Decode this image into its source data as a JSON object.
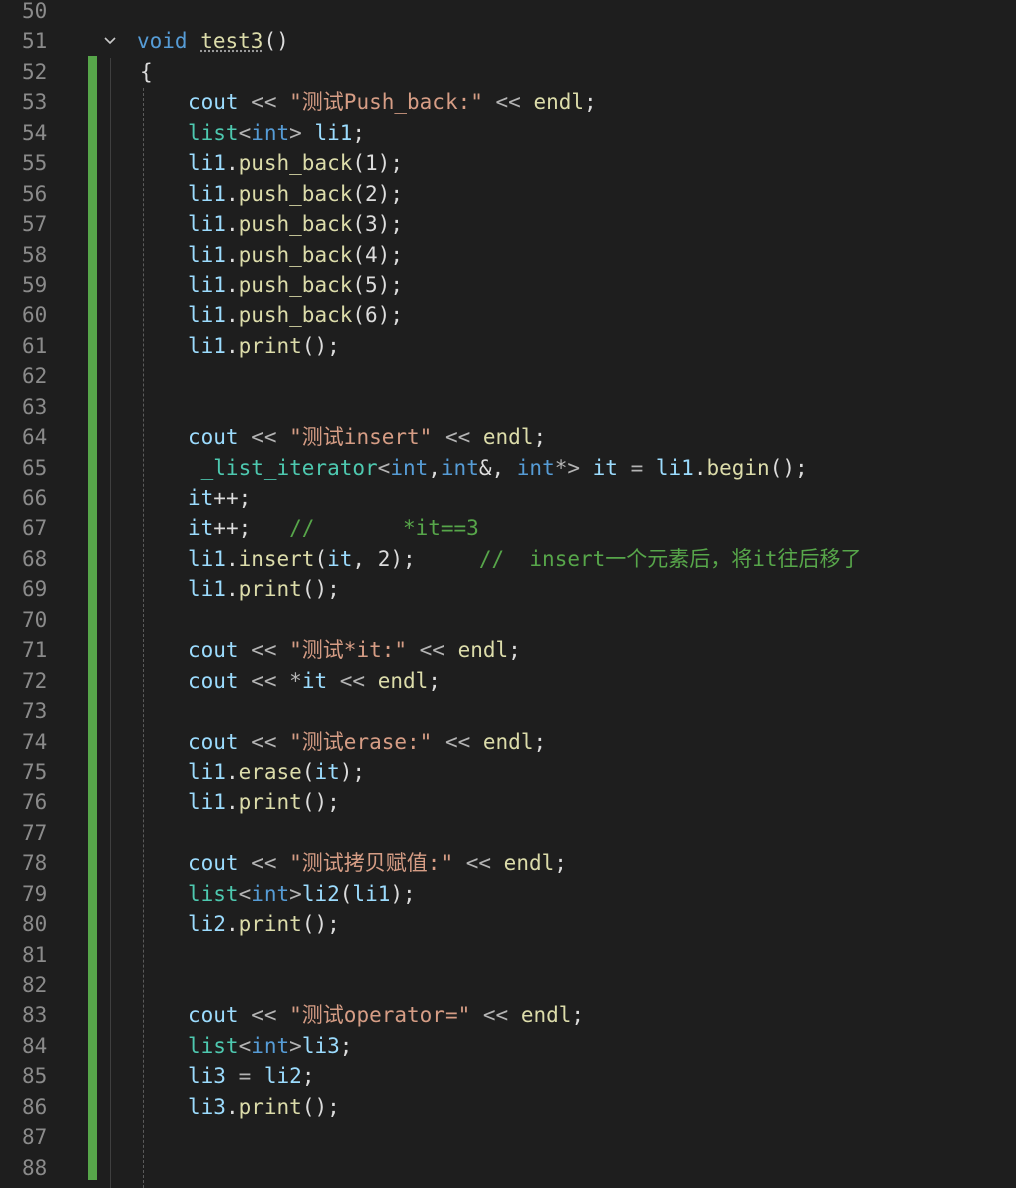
{
  "editor": {
    "lines": [
      {
        "n": "50",
        "indent": "none",
        "tokens": []
      },
      {
        "n": "51",
        "indent": "top",
        "fold": "⌵",
        "tokens": [
          {
            "t": "void",
            "c": "kw"
          },
          {
            "t": " ",
            "c": "def"
          },
          {
            "t": "test3",
            "c": "fn",
            "u": true
          },
          {
            "t": "()",
            "c": "def"
          }
        ]
      },
      {
        "n": "52",
        "indent": "brace",
        "tokens": [
          {
            "t": "{",
            "c": "def"
          }
        ]
      },
      {
        "n": "53",
        "indent": "body",
        "tokens": [
          {
            "t": "cout",
            "c": "var"
          },
          {
            "t": " << ",
            "c": "op"
          },
          {
            "t": "\"测试Push_back:\"",
            "c": "str"
          },
          {
            "t": " << ",
            "c": "op"
          },
          {
            "t": "endl",
            "c": "fn"
          },
          {
            "t": ";",
            "c": "def"
          }
        ]
      },
      {
        "n": "54",
        "indent": "body",
        "tokens": [
          {
            "t": "list",
            "c": "type"
          },
          {
            "t": "<",
            "c": "op"
          },
          {
            "t": "int",
            "c": "kw"
          },
          {
            "t": ">",
            "c": "op"
          },
          {
            "t": " li1",
            "c": "var"
          },
          {
            "t": ";",
            "c": "def"
          }
        ]
      },
      {
        "n": "55",
        "indent": "body",
        "tokens": [
          {
            "t": "li1",
            "c": "var"
          },
          {
            "t": ".",
            "c": "def"
          },
          {
            "t": "push_back",
            "c": "fn"
          },
          {
            "t": "(1);",
            "c": "def"
          }
        ]
      },
      {
        "n": "56",
        "indent": "body",
        "tokens": [
          {
            "t": "li1",
            "c": "var"
          },
          {
            "t": ".",
            "c": "def"
          },
          {
            "t": "push_back",
            "c": "fn"
          },
          {
            "t": "(2);",
            "c": "def"
          }
        ]
      },
      {
        "n": "57",
        "indent": "body",
        "tokens": [
          {
            "t": "li1",
            "c": "var"
          },
          {
            "t": ".",
            "c": "def"
          },
          {
            "t": "push_back",
            "c": "fn"
          },
          {
            "t": "(3);",
            "c": "def"
          }
        ]
      },
      {
        "n": "58",
        "indent": "body",
        "tokens": [
          {
            "t": "li1",
            "c": "var"
          },
          {
            "t": ".",
            "c": "def"
          },
          {
            "t": "push_back",
            "c": "fn"
          },
          {
            "t": "(4);",
            "c": "def"
          }
        ]
      },
      {
        "n": "59",
        "indent": "body",
        "tokens": [
          {
            "t": "li1",
            "c": "var"
          },
          {
            "t": ".",
            "c": "def"
          },
          {
            "t": "push_back",
            "c": "fn"
          },
          {
            "t": "(5);",
            "c": "def"
          }
        ]
      },
      {
        "n": "60",
        "indent": "body",
        "tokens": [
          {
            "t": "li1",
            "c": "var"
          },
          {
            "t": ".",
            "c": "def"
          },
          {
            "t": "push_back",
            "c": "fn"
          },
          {
            "t": "(6);",
            "c": "def"
          }
        ]
      },
      {
        "n": "61",
        "indent": "body",
        "tokens": [
          {
            "t": "li1",
            "c": "var"
          },
          {
            "t": ".",
            "c": "def"
          },
          {
            "t": "print",
            "c": "fn"
          },
          {
            "t": "();",
            "c": "def"
          }
        ]
      },
      {
        "n": "62",
        "indent": "body",
        "tokens": []
      },
      {
        "n": "63",
        "indent": "body",
        "tokens": []
      },
      {
        "n": "64",
        "indent": "body",
        "tokens": [
          {
            "t": "cout",
            "c": "var"
          },
          {
            "t": " << ",
            "c": "op"
          },
          {
            "t": "\"测试insert\"",
            "c": "str"
          },
          {
            "t": " << ",
            "c": "op"
          },
          {
            "t": "endl",
            "c": "fn"
          },
          {
            "t": ";",
            "c": "def"
          }
        ]
      },
      {
        "n": "65",
        "indent": "body",
        "tokens": [
          {
            "t": " _list_iterator",
            "c": "type"
          },
          {
            "t": "<",
            "c": "op"
          },
          {
            "t": "int",
            "c": "kw"
          },
          {
            "t": ",",
            "c": "def"
          },
          {
            "t": "int",
            "c": "kw"
          },
          {
            "t": "&, ",
            "c": "def"
          },
          {
            "t": "int",
            "c": "kw"
          },
          {
            "t": "*>",
            "c": "op"
          },
          {
            "t": " it",
            "c": "var"
          },
          {
            "t": " = ",
            "c": "op"
          },
          {
            "t": "li1",
            "c": "var"
          },
          {
            "t": ".",
            "c": "def"
          },
          {
            "t": "begin",
            "c": "fn"
          },
          {
            "t": "();",
            "c": "def"
          }
        ]
      },
      {
        "n": "66",
        "indent": "body",
        "tokens": [
          {
            "t": "it",
            "c": "var"
          },
          {
            "t": "++;",
            "c": "def"
          }
        ]
      },
      {
        "n": "67",
        "indent": "body",
        "tokens": [
          {
            "t": "it",
            "c": "var"
          },
          {
            "t": "++;",
            "c": "def"
          },
          {
            "t": "   //       *it==3",
            "c": "cmt"
          }
        ]
      },
      {
        "n": "68",
        "indent": "body",
        "tokens": [
          {
            "t": "li1",
            "c": "var"
          },
          {
            "t": ".",
            "c": "def"
          },
          {
            "t": "insert",
            "c": "fn"
          },
          {
            "t": "(",
            "c": "def"
          },
          {
            "t": "it",
            "c": "var"
          },
          {
            "t": ", 2);",
            "c": "def"
          },
          {
            "t": "     //  insert一个元素后，将it往后移了",
            "c": "cmt"
          }
        ]
      },
      {
        "n": "69",
        "indent": "body",
        "tokens": [
          {
            "t": "li1",
            "c": "var"
          },
          {
            "t": ".",
            "c": "def"
          },
          {
            "t": "print",
            "c": "fn"
          },
          {
            "t": "();",
            "c": "def"
          }
        ]
      },
      {
        "n": "70",
        "indent": "body",
        "tokens": []
      },
      {
        "n": "71",
        "indent": "body",
        "tokens": [
          {
            "t": "cout",
            "c": "var"
          },
          {
            "t": " << ",
            "c": "op"
          },
          {
            "t": "\"测试*it:\"",
            "c": "str"
          },
          {
            "t": " << ",
            "c": "op"
          },
          {
            "t": "endl",
            "c": "fn"
          },
          {
            "t": ";",
            "c": "def"
          }
        ]
      },
      {
        "n": "72",
        "indent": "body",
        "tokens": [
          {
            "t": "cout",
            "c": "var"
          },
          {
            "t": " << ",
            "c": "op"
          },
          {
            "t": "*",
            "c": "op"
          },
          {
            "t": "it",
            "c": "var"
          },
          {
            "t": " << ",
            "c": "op"
          },
          {
            "t": "endl",
            "c": "fn"
          },
          {
            "t": ";",
            "c": "def"
          }
        ]
      },
      {
        "n": "73",
        "indent": "body",
        "tokens": []
      },
      {
        "n": "74",
        "indent": "body",
        "tokens": [
          {
            "t": "cout",
            "c": "var"
          },
          {
            "t": " << ",
            "c": "op"
          },
          {
            "t": "\"测试erase:\"",
            "c": "str"
          },
          {
            "t": " << ",
            "c": "op"
          },
          {
            "t": "endl",
            "c": "fn"
          },
          {
            "t": ";",
            "c": "def"
          }
        ]
      },
      {
        "n": "75",
        "indent": "body",
        "tokens": [
          {
            "t": "li1",
            "c": "var"
          },
          {
            "t": ".",
            "c": "def"
          },
          {
            "t": "erase",
            "c": "fn"
          },
          {
            "t": "(",
            "c": "def"
          },
          {
            "t": "it",
            "c": "var"
          },
          {
            "t": ");",
            "c": "def"
          }
        ]
      },
      {
        "n": "76",
        "indent": "body",
        "tokens": [
          {
            "t": "li1",
            "c": "var"
          },
          {
            "t": ".",
            "c": "def"
          },
          {
            "t": "print",
            "c": "fn"
          },
          {
            "t": "();",
            "c": "def"
          }
        ]
      },
      {
        "n": "77",
        "indent": "body",
        "tokens": []
      },
      {
        "n": "78",
        "indent": "body",
        "tokens": [
          {
            "t": "cout",
            "c": "var"
          },
          {
            "t": " << ",
            "c": "op"
          },
          {
            "t": "\"测试拷贝赋值:\"",
            "c": "str"
          },
          {
            "t": " << ",
            "c": "op"
          },
          {
            "t": "endl",
            "c": "fn"
          },
          {
            "t": ";",
            "c": "def"
          }
        ]
      },
      {
        "n": "79",
        "indent": "body",
        "tokens": [
          {
            "t": "list",
            "c": "type"
          },
          {
            "t": "<",
            "c": "op"
          },
          {
            "t": "int",
            "c": "kw"
          },
          {
            "t": ">",
            "c": "op"
          },
          {
            "t": "li2",
            "c": "var"
          },
          {
            "t": "(",
            "c": "def"
          },
          {
            "t": "li1",
            "c": "var"
          },
          {
            "t": ");",
            "c": "def"
          }
        ]
      },
      {
        "n": "80",
        "indent": "body",
        "tokens": [
          {
            "t": "li2",
            "c": "var"
          },
          {
            "t": ".",
            "c": "def"
          },
          {
            "t": "print",
            "c": "fn"
          },
          {
            "t": "();",
            "c": "def"
          }
        ]
      },
      {
        "n": "81",
        "indent": "body",
        "tokens": []
      },
      {
        "n": "82",
        "indent": "body",
        "tokens": []
      },
      {
        "n": "83",
        "indent": "body",
        "tokens": [
          {
            "t": "cout",
            "c": "var"
          },
          {
            "t": " << ",
            "c": "op"
          },
          {
            "t": "\"测试operator=\"",
            "c": "str"
          },
          {
            "t": " << ",
            "c": "op"
          },
          {
            "t": "endl",
            "c": "fn"
          },
          {
            "t": ";",
            "c": "def"
          }
        ]
      },
      {
        "n": "84",
        "indent": "body",
        "tokens": [
          {
            "t": "list",
            "c": "type"
          },
          {
            "t": "<",
            "c": "op"
          },
          {
            "t": "int",
            "c": "kw"
          },
          {
            "t": ">",
            "c": "op"
          },
          {
            "t": "li3",
            "c": "var"
          },
          {
            "t": ";",
            "c": "def"
          }
        ]
      },
      {
        "n": "85",
        "indent": "body",
        "tokens": [
          {
            "t": "li3",
            "c": "var"
          },
          {
            "t": " = ",
            "c": "op"
          },
          {
            "t": "li2",
            "c": "var"
          },
          {
            "t": ";",
            "c": "def"
          }
        ]
      },
      {
        "n": "86",
        "indent": "body",
        "tokens": [
          {
            "t": "li3",
            "c": "var"
          },
          {
            "t": ".",
            "c": "def"
          },
          {
            "t": "print",
            "c": "fn"
          },
          {
            "t": "();",
            "c": "def"
          }
        ]
      },
      {
        "n": "87",
        "indent": "body",
        "tokens": []
      },
      {
        "n": "88",
        "indent": "body",
        "tokens": []
      }
    ]
  }
}
